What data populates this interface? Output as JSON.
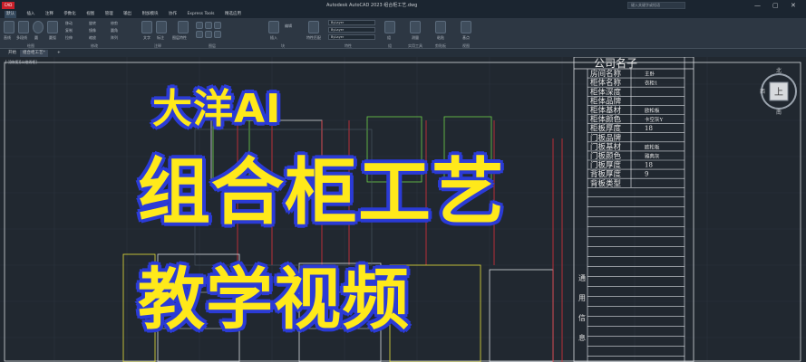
{
  "app": {
    "logo_text": "CAD",
    "window_title": "Autodesk AutoCAD 2023    组合柜工艺.dwg",
    "search_placeholder": "键入关键字或短语",
    "minimize": "—",
    "maximize": "▢",
    "close": "✕"
  },
  "menu": [
    "默认",
    "插入",
    "注释",
    "参数化",
    "视图",
    "管理",
    "输出",
    "附加模块",
    "协作",
    "Express Tools",
    "精选应用"
  ],
  "ribbon": {
    "groups": [
      "绘图",
      "修改",
      "注释",
      "图层",
      "块",
      "特性",
      "组",
      "实用工具",
      "剪贴板",
      "视图"
    ],
    "layer_dropdown": "ByLayer",
    "linetype_dropdown": "ByLayer",
    "lineweight_dropdown": "ByLayer",
    "tool_labels": [
      "直线",
      "多段线",
      "圆",
      "圆弧",
      "移动",
      "旋转",
      "修剪",
      "复制",
      "镜像",
      "圆角",
      "拉伸",
      "缩放",
      "阵列",
      "文字",
      "标注",
      "图层特性",
      "插入",
      "编辑",
      "特性匹配",
      "组",
      "测量",
      "粘贴",
      "基点"
    ]
  },
  "tabs": {
    "start": "开始",
    "drawing": "组合柜工艺*",
    "add": "+"
  },
  "viewport_label": "[-][俯视][二维线框]",
  "title_block": {
    "company": "公司名子",
    "rows": [
      {
        "label": "房间名称",
        "value": "主卧"
      },
      {
        "label": "柜体名称",
        "value": "衣柜1"
      },
      {
        "label": "柜体深度",
        "value": ""
      },
      {
        "label": "柜体品牌",
        "value": ""
      },
      {
        "label": "柜体基材",
        "value": "欧松板"
      },
      {
        "label": "柜体颜色",
        "value": "卡空灰Y"
      },
      {
        "label": "柜板厚度",
        "value": "18"
      },
      {
        "label": "门板品牌",
        "value": ""
      },
      {
        "label": "门板基材",
        "value": "欧松板"
      },
      {
        "label": "门板颜色",
        "value": "雅典灰"
      },
      {
        "label": "门板厚度",
        "value": "18"
      },
      {
        "label": "背板厚度",
        "value": "9"
      },
      {
        "label": "背板类型",
        "value": ""
      }
    ],
    "side_label": [
      "通",
      "用",
      "信",
      "息"
    ]
  },
  "overlay": {
    "line1": "大洋AI",
    "line2": "组合柜工艺",
    "line3": "教学视频"
  },
  "viewcube": {
    "north": "北",
    "south": "南",
    "west": "西",
    "face": "上",
    "wcs": "WCS"
  },
  "colors": {
    "overlay_fill": "#ffe91a",
    "overlay_stroke": "#2b3bd6",
    "canvas_bg": "#212830",
    "red_line": "#e0303a",
    "green_line": "#6fd34a",
    "yellow_line": "#e8e23a"
  }
}
